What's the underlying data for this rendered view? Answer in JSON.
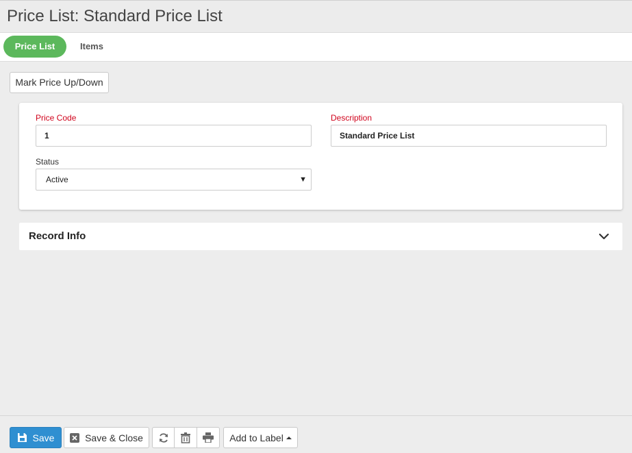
{
  "header": {
    "title": "Price List: Standard Price List"
  },
  "tabs": [
    {
      "label": "Price List",
      "active": true
    },
    {
      "label": "Items",
      "active": false
    }
  ],
  "toolbar": {
    "mark_price_label": "Mark Price Up/Down"
  },
  "form": {
    "price_code": {
      "label": "Price Code",
      "value": "1",
      "required": true
    },
    "description": {
      "label": "Description",
      "value": "Standard Price List",
      "required": true
    },
    "status": {
      "label": "Status",
      "value": "Active"
    }
  },
  "record_info": {
    "title": "Record Info",
    "icon": "chevron-down-icon"
  },
  "footer": {
    "save_label": "Save",
    "save_close_label": "Save & Close",
    "add_to_label": "Add to Label",
    "icons": [
      "save-icon",
      "close-box-icon",
      "refresh-icon",
      "trash-icon",
      "print-icon",
      "caret-up-icon"
    ]
  },
  "colors": {
    "active_tab": "#5cb85c",
    "save_button": "#2f8fd1",
    "required_label": "#d0021b"
  }
}
